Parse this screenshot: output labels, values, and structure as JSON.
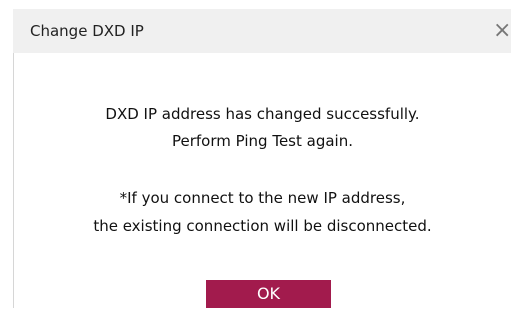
{
  "dialog": {
    "title": "Change DXD IP",
    "close_label": "×",
    "messages": [
      "DXD IP address has changed successfully.",
      "Perform Ping Test again.",
      "*If you connect to the new IP address,",
      "the existing connection will be disconnected."
    ],
    "ok_label": "OK"
  },
  "colors": {
    "titlebar_background": "#f0f0f0",
    "button_background": "#a21b4d",
    "button_text": "#ffffff",
    "body_text": "#111111"
  },
  "icons": {
    "close": "close-icon"
  }
}
